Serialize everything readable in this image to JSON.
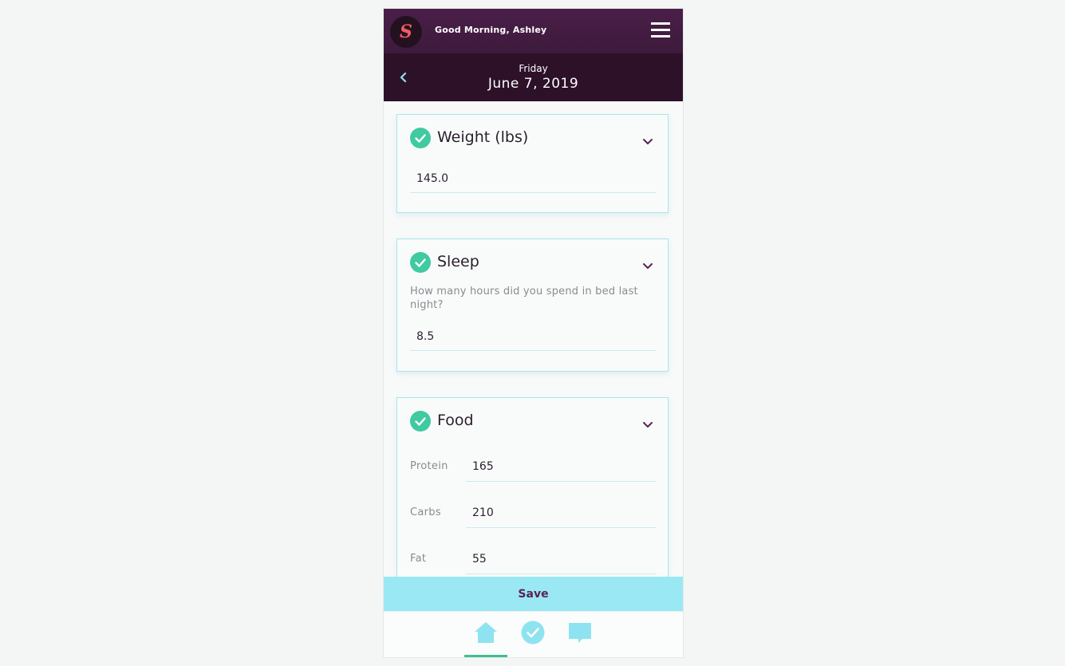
{
  "header": {
    "logo_letter": "S",
    "greeting": "Good Morning, Ashley",
    "menu_icon": "hamburger-menu-icon"
  },
  "date_nav": {
    "back_icon": "chevron-left-icon",
    "weekday": "Friday",
    "date": "June 7, 2019"
  },
  "cards": {
    "weight": {
      "title": "Weight (lbs)",
      "value": "145.0"
    },
    "sleep": {
      "title": "Sleep",
      "question": "How many hours did you spend in bed last night?",
      "value": "8.5"
    },
    "food": {
      "title": "Food",
      "macros": [
        {
          "label": "Protein",
          "value": "165"
        },
        {
          "label": "Carbs",
          "value": "210"
        },
        {
          "label": "Fat",
          "value": "55"
        }
      ]
    }
  },
  "save_label": "Save",
  "bottom_nav": {
    "items": [
      "home-icon",
      "check-circle-icon",
      "chat-icon"
    ],
    "active": "home-icon"
  },
  "colors": {
    "header": "#4a1f48",
    "date_bar": "#2d1129",
    "accent_check": "#3fcaa0",
    "save_bar": "#99e8f3",
    "logo_letter": "#f05a63",
    "nav_icon": "#8ee3f0"
  }
}
